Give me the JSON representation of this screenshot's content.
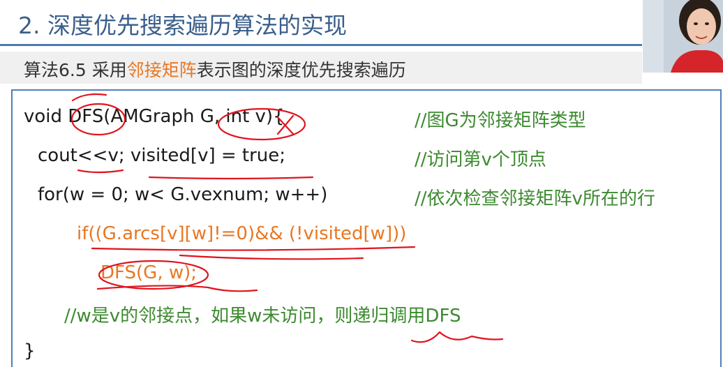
{
  "header": {
    "title": "2. 深度优先搜索遍历算法的实现"
  },
  "subtitle": {
    "prefix": "算法6.5   采用",
    "highlight": "邻接矩阵",
    "suffix": "表示图的深度优先搜索遍历"
  },
  "code": {
    "lines": [
      "void DFS(AMGraph G, int v){",
      "cout<<v;  visited[v] = true;",
      "for(w = 0; w< G.vexnum; w++)",
      "if((G.arcs[v][w]!=0)&& (!visited[w]))",
      "DFS(G, w);",
      "//w是v的邻接点，如果w未访问，则递归调用DFS",
      "}"
    ],
    "comments": [
      "//图G为邻接矩阵类型",
      "//访问第v个顶点",
      "//依次检查邻接矩阵v所在的行"
    ]
  },
  "colors": {
    "title": "#3a5f8c",
    "accent": "#e87722",
    "comment": "#3c8a2f",
    "border": "#4f80b8",
    "annotation": "#e0141e"
  }
}
